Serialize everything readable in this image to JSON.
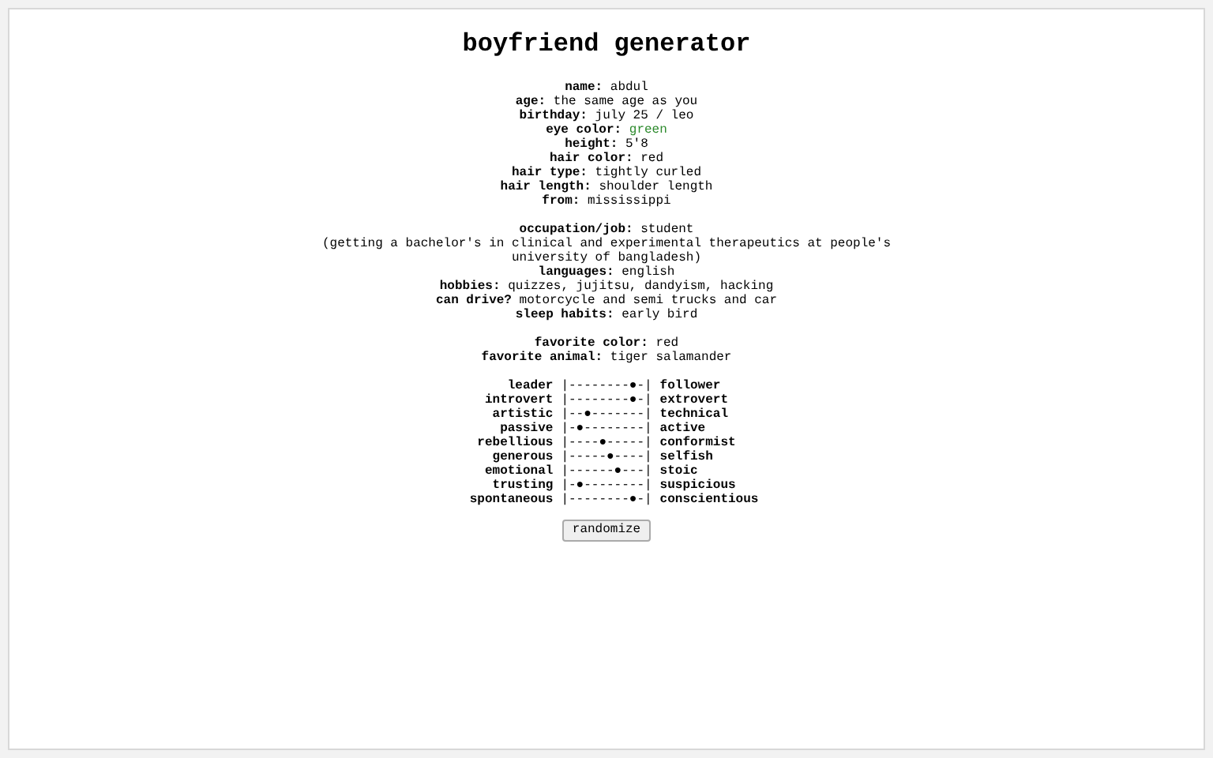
{
  "title": "boyfriend generator",
  "sections": [
    {
      "fields": [
        {
          "label": "name:",
          "value": "abdul"
        },
        {
          "label": "age:",
          "value": "the same age as you"
        },
        {
          "label": "birthday:",
          "value": "july 25 / leo"
        },
        {
          "label": "eye color:",
          "value": "green",
          "color": "#2e8b2e"
        },
        {
          "label": "height:",
          "value": "5'8"
        },
        {
          "label": "hair color:",
          "value": "red"
        },
        {
          "label": "hair type:",
          "value": "tightly curled"
        },
        {
          "label": "hair length:",
          "value": "shoulder length"
        },
        {
          "label": "from:",
          "value": "mississippi"
        }
      ]
    },
    {
      "fields": [
        {
          "label": "occupation/job:",
          "value": "student",
          "detail": "(getting a bachelor's in clinical and experimental therapeutics at people's university of bangladesh)"
        },
        {
          "label": "languages:",
          "value": "english"
        },
        {
          "label": "hobbies:",
          "value": "quizzes, jujitsu, dandyism, hacking"
        },
        {
          "label": "can drive?",
          "value": "motorcycle and semi trucks and car"
        },
        {
          "label": "sleep habits:",
          "value": "early bird"
        }
      ]
    },
    {
      "fields": [
        {
          "label": "favorite color:",
          "value": "red"
        },
        {
          "label": "favorite animal:",
          "value": "tiger salamander"
        }
      ]
    }
  ],
  "traits": [
    {
      "left": "leader",
      "scale": "|--------●-|",
      "right": "follower"
    },
    {
      "left": "introvert",
      "scale": "|--------●-|",
      "right": "extrovert"
    },
    {
      "left": "artistic",
      "scale": "|--●-------|",
      "right": "technical"
    },
    {
      "left": "passive",
      "scale": "|-●--------|",
      "right": "active"
    },
    {
      "left": "rebellious",
      "scale": "|----●-----|",
      "right": "conformist"
    },
    {
      "left": "generous",
      "scale": "|-----●----|",
      "right": "selfish"
    },
    {
      "left": "emotional",
      "scale": "|------●---|",
      "right": "stoic"
    },
    {
      "left": "trusting",
      "scale": "|-●--------|",
      "right": "suspicious"
    },
    {
      "left": "spontaneous",
      "scale": "|--------●-|",
      "right": "conscientious"
    }
  ],
  "button": "randomize"
}
